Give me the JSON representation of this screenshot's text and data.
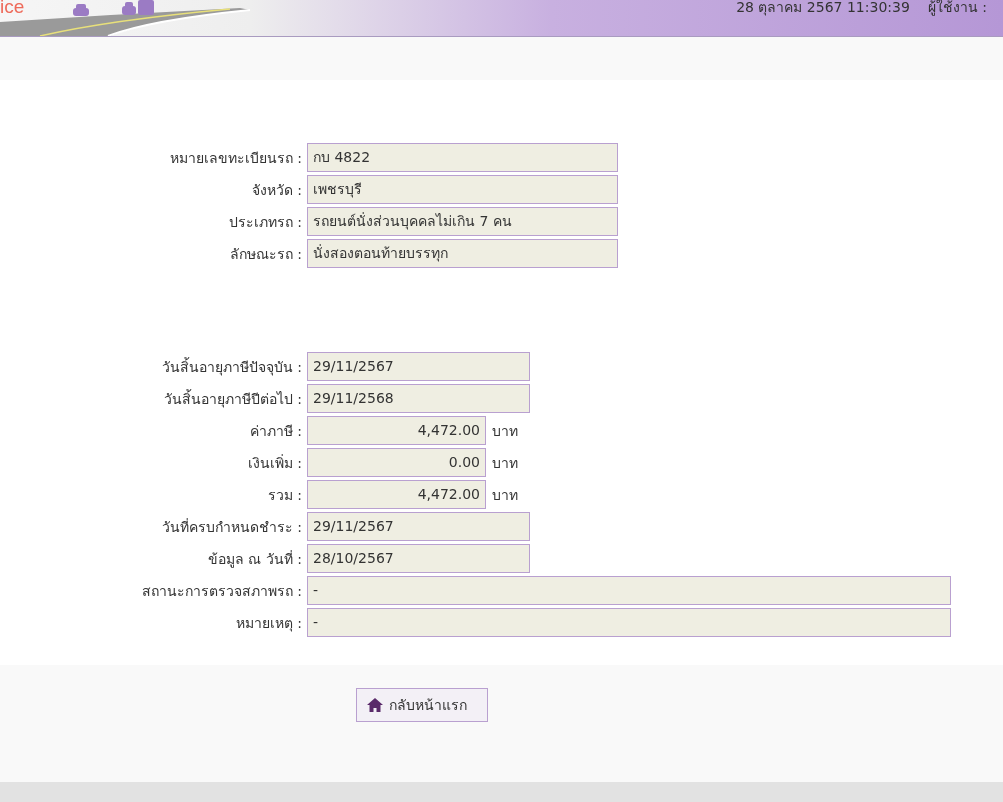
{
  "header": {
    "logo_text": "ice",
    "datetime": "28 ตุลาคม 2567 11:30:39",
    "user_label": "ผู้ใช้งาน :"
  },
  "vehicle": [
    {
      "label": "หมายเลขทะเบียนรถ :",
      "value": "กบ 4822",
      "kind": "long"
    },
    {
      "label": "จังหวัด :",
      "value": "เพชรบุรี",
      "kind": "long"
    },
    {
      "label": "ประเภทรถ :",
      "value": "รถยนต์นั่งส่วนบุคคลไม่เกิน 7 คน",
      "kind": "long"
    },
    {
      "label": "ลักษณะรถ :",
      "value": "นั่งสองตอนท้ายบรรทุก",
      "kind": "long"
    }
  ],
  "tax": [
    {
      "label": "วันสิ้นอายุภาษีปัจจุบัน :",
      "value": "29/11/2567",
      "kind": "medium"
    },
    {
      "label": "วันสิ้นอายุภาษีปีต่อไป :",
      "value": "29/11/2568",
      "kind": "medium"
    },
    {
      "label": "ค่าภาษี :",
      "value": "4,472.00",
      "kind": "short",
      "unit": "บาท"
    },
    {
      "label": "เงินเพิ่ม :",
      "value": "0.00",
      "kind": "short",
      "unit": "บาท"
    },
    {
      "label": "รวม :",
      "value": "4,472.00",
      "kind": "short",
      "unit": "บาท"
    },
    {
      "label": "วันที่ครบกำหนดชำระ :",
      "value": "29/11/2567",
      "kind": "medium"
    },
    {
      "label": "ข้อมูล ณ วันที่ :",
      "value": "28/10/2567",
      "kind": "medium"
    },
    {
      "label": "สถานะการตรวจสภาพรถ :",
      "value": "-",
      "kind": "full"
    },
    {
      "label": "หมายเหตุ :",
      "value": "-",
      "kind": "full"
    }
  ],
  "home_button": "กลับหน้าแรก"
}
